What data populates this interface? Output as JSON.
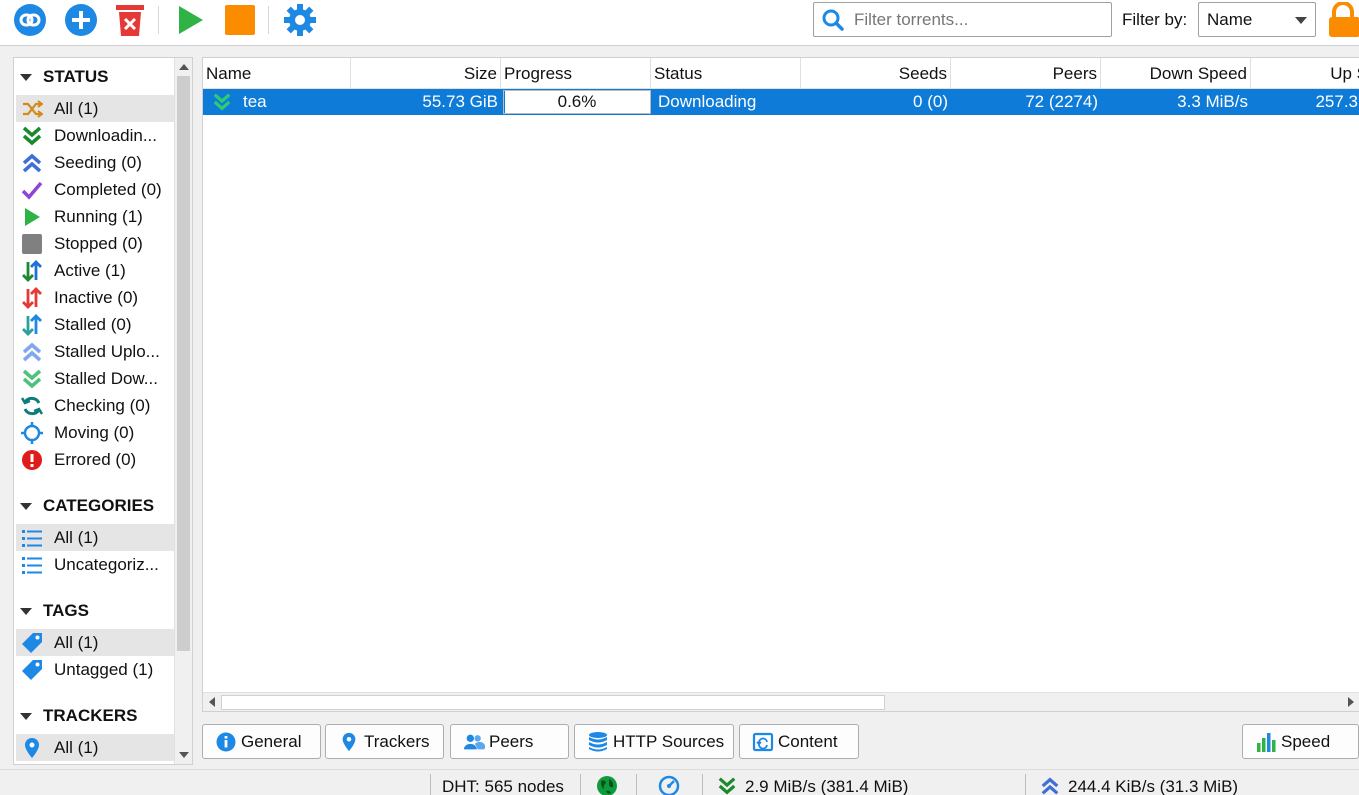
{
  "toolbar": {
    "buttons": [
      {
        "name": "add-link",
        "icon": "link-icon"
      },
      {
        "name": "add-torrent",
        "icon": "plus-circle-icon"
      },
      {
        "name": "remove",
        "icon": "trash-icon"
      },
      {
        "name": "start",
        "icon": "play-icon"
      },
      {
        "name": "stop",
        "icon": "stop-icon"
      },
      {
        "name": "options",
        "icon": "gear-icon"
      }
    ],
    "search_placeholder": "Filter torrents...",
    "filter_label": "Filter by:",
    "filter_value": "Name"
  },
  "sidebar": {
    "status_header": "STATUS",
    "status_items": [
      {
        "label": "All (1)",
        "icon": "shuffle-icon"
      },
      {
        "label": "Downloadin...",
        "icon": "download-chevrons-icon"
      },
      {
        "label": "Seeding (0)",
        "icon": "upload-chevrons-icon"
      },
      {
        "label": "Completed (0)",
        "icon": "check-icon"
      },
      {
        "label": "Running (1)",
        "icon": "play-icon"
      },
      {
        "label": "Stopped (0)",
        "icon": "stop-square-icon"
      },
      {
        "label": "Active (1)",
        "icon": "active-arrows-icon"
      },
      {
        "label": "Inactive (0)",
        "icon": "inactive-arrows-icon"
      },
      {
        "label": "Stalled (0)",
        "icon": "stalled-arrows-icon"
      },
      {
        "label": "Stalled Uplo...",
        "icon": "stalled-upload-icon"
      },
      {
        "label": "Stalled Dow...",
        "icon": "stalled-download-icon"
      },
      {
        "label": "Checking (0)",
        "icon": "refresh-icon"
      },
      {
        "label": "Moving (0)",
        "icon": "crosshair-icon"
      },
      {
        "label": "Errored (0)",
        "icon": "error-icon"
      }
    ],
    "categories_header": "CATEGORIES",
    "category_items": [
      {
        "label": "All (1)",
        "icon": "list-icon"
      },
      {
        "label": "Uncategoriz...",
        "icon": "list-icon"
      }
    ],
    "tags_header": "TAGS",
    "tag_items": [
      {
        "label": "All (1)",
        "icon": "tag-icon"
      },
      {
        "label": "Untagged (1)",
        "icon": "tag-icon"
      }
    ],
    "trackers_header": "TRACKERS",
    "tracker_items": [
      {
        "label": "All (1)",
        "icon": "map-pin-icon"
      }
    ]
  },
  "table": {
    "columns": [
      "Name",
      "Size",
      "Progress",
      "Status",
      "Seeds",
      "Peers",
      "Down Speed",
      "Up S"
    ],
    "rows": [
      {
        "name": "tea",
        "size": "55.73 GiB",
        "progress_text": "0.6%",
        "progress": 0.006,
        "status": "Downloading",
        "seeds": "0 (0)",
        "peers": "72 (2274)",
        "down_speed": "3.3 MiB/s",
        "up_speed": "257.3"
      }
    ]
  },
  "tabs": [
    "General",
    "Trackers",
    "Peers",
    "HTTP Sources",
    "Content"
  ],
  "speed_button": "Speed",
  "statusbar": {
    "dht": "DHT: 565 nodes",
    "download": "2.9 MiB/s (381.4 MiB)",
    "upload": "244.4 KiB/s (31.3 MiB)"
  },
  "colors": {
    "selection": "#0d7bd7",
    "accent_blue": "#1e88e5",
    "green": "#2fb344",
    "orange": "#fb8c00",
    "red": "#e53935"
  }
}
